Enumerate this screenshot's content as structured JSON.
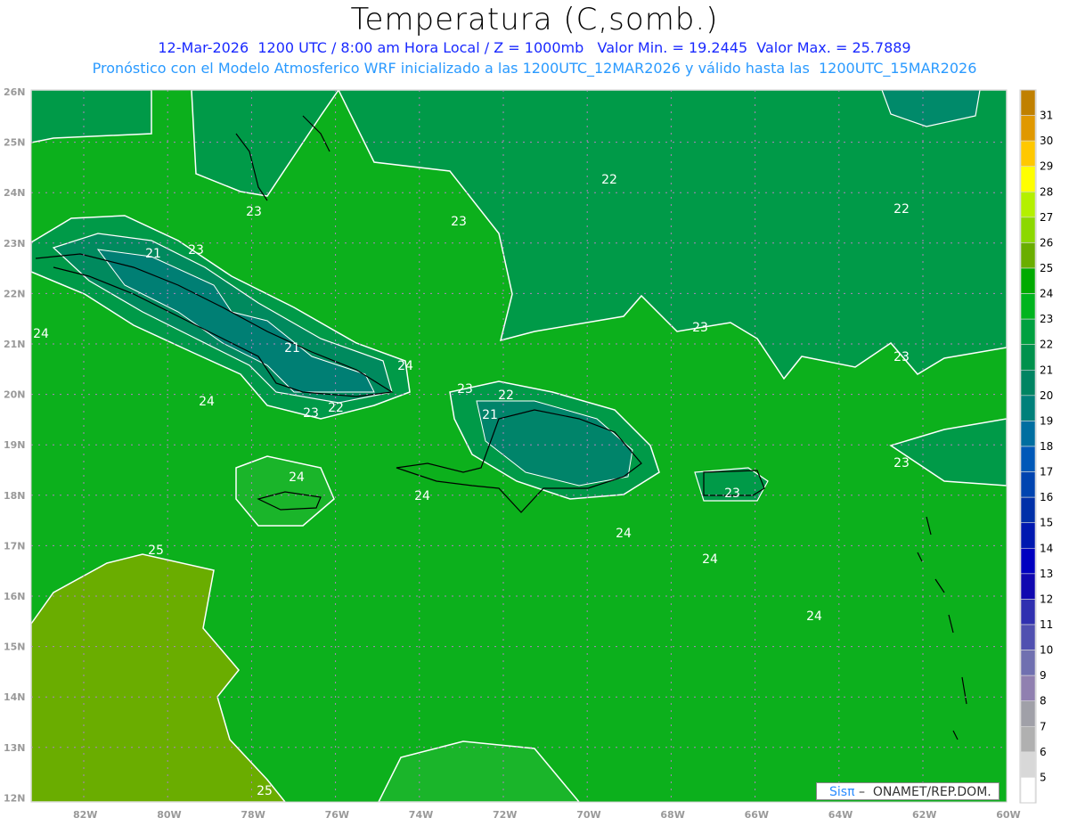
{
  "header": {
    "title": "Temperatura (C,somb.)",
    "line1": "12-Mar-2026  1200 UTC / 8:00 am Hora Local / Z = 1000mb   Valor Min. = 19.2445  Valor Max. = 25.7889",
    "line2": "Pronóstico con el Modelo Atmosferico WRF inicializado a las 1200UTC_12MAR2026 y válido hasta las  1200UTC_15MAR2026"
  },
  "map": {
    "variable": "Temperatura",
    "units": "C",
    "level": "1000mb",
    "valid_time": "12-Mar-2026 1200 UTC",
    "min_value": 19.2445,
    "max_value": 25.7889,
    "lat_labels": [
      "26N",
      "25N",
      "24N",
      "23N",
      "22N",
      "21N",
      "20N",
      "19N",
      "18N",
      "17N",
      "16N",
      "15N",
      "14N",
      "13N",
      "12N"
    ],
    "lon_labels": [
      "82W",
      "80W",
      "78W",
      "76W",
      "74W",
      "72W",
      "70W",
      "68W",
      "66W",
      "64W",
      "62W",
      "60W"
    ],
    "contour_labels": [
      "23",
      "21",
      "23",
      "22",
      "22",
      "23",
      "24",
      "21",
      "24",
      "24",
      "23",
      "22",
      "23",
      "22",
      "21",
      "23",
      "23",
      "23",
      "24",
      "24",
      "23",
      "24",
      "24",
      "25",
      "24",
      "25"
    ]
  },
  "colorbar": {
    "labels": [
      "31",
      "30",
      "29",
      "28",
      "27",
      "26",
      "25",
      "24",
      "23",
      "22",
      "21",
      "20",
      "19",
      "18",
      "17",
      "16",
      "15",
      "14",
      "13",
      "12",
      "11",
      "10",
      "9",
      "8",
      "7",
      "6",
      "5"
    ],
    "colors": [
      "#c08000",
      "#e09800",
      "#ffc800",
      "#ffff00",
      "#b4f000",
      "#8cd800",
      "#6aae00",
      "#00aa00",
      "#00b41e",
      "#00a040",
      "#00914c",
      "#008462",
      "#00807a",
      "#006ea0",
      "#0058b8",
      "#0044b0",
      "#0030a8",
      "#0018b0",
      "#0000c0",
      "#1008b0",
      "#3030b0",
      "#5050b0",
      "#7070b0",
      "#9080b0",
      "#a0a0a8",
      "#b0b0b0",
      "#d8d8d8",
      "#ffffff"
    ]
  },
  "logo": {
    "brand": "Sisπ",
    "text": " –  ONAMET/REP.DOM."
  }
}
